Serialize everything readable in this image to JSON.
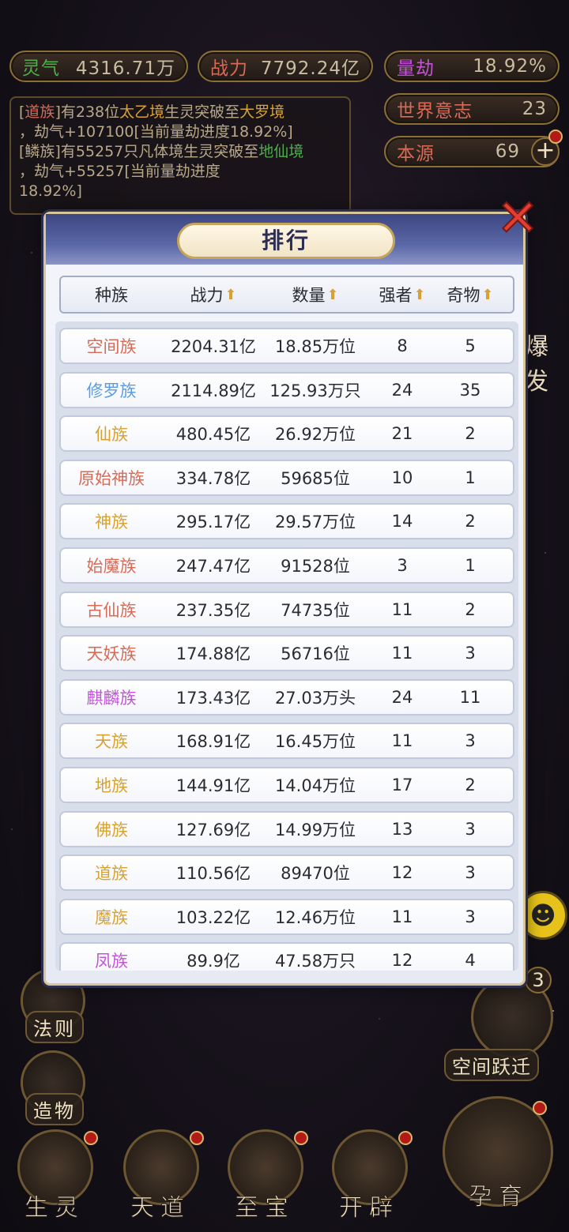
{
  "top_stats": {
    "lingqi": {
      "label": "灵气",
      "value": "4316.71万"
    },
    "zhanli": {
      "label": "战力",
      "value": "7792.24亿"
    },
    "liangjie": {
      "label": "量劫",
      "value": "18.92%"
    },
    "world_will": {
      "label": "世界意志",
      "value": "23"
    },
    "benyuan": {
      "label": "本源",
      "value": "69"
    }
  },
  "colors": {
    "red": "#d96a56",
    "gold": "#d7a234",
    "green": "#4bb04a",
    "blue": "#5b9be0",
    "purple": "#c254d6"
  },
  "log": {
    "line1_a": "[",
    "line1_race": "道族",
    "line1_b": "]有238位",
    "line1_realm1": "太乙境",
    "line1_c": "生灵突破至",
    "line1_realm2": "大罗境",
    "line2": "，劫气+107100[当前量劫进度18.92%]",
    "line3_a": "[鳞族]有55257只凡体境生灵突破至",
    "line3_realm": "地仙境",
    "line4": "，劫气+55257[当前量劫进度",
    "line5": "18.92%]"
  },
  "side": {
    "fa_ze": "法则",
    "zao_wu": "造物",
    "kong_jian": "空间跃迁",
    "bao_fa": "爆发",
    "badge": "3"
  },
  "bottom": {
    "sheng_ling": "生灵",
    "tian_dao": "天道",
    "zhi_bao": "至宝",
    "kai_pi": "开辟",
    "yun_yu": "孕育"
  },
  "modal": {
    "title": "排行",
    "close_icon": "close-x-icon",
    "columns": {
      "race": "种族",
      "power": "战力",
      "count": "数量",
      "strong": "强者",
      "treasure": "奇物"
    },
    "sort_arrow": "⬆",
    "rows": [
      {
        "race": "空间族",
        "color": "#d96a56",
        "power": "2204.31亿",
        "count": "18.85万位",
        "strong": "8",
        "treasure": "5"
      },
      {
        "race": "修罗族",
        "color": "#5b9be0",
        "power": "2114.89亿",
        "count": "125.93万只",
        "strong": "24",
        "treasure": "35"
      },
      {
        "race": "仙族",
        "color": "#d7a234",
        "power": "480.45亿",
        "count": "26.92万位",
        "strong": "21",
        "treasure": "2"
      },
      {
        "race": "原始神族",
        "color": "#d96a56",
        "power": "334.78亿",
        "count": "59685位",
        "strong": "10",
        "treasure": "1"
      },
      {
        "race": "神族",
        "color": "#d7a234",
        "power": "295.17亿",
        "count": "29.57万位",
        "strong": "14",
        "treasure": "2"
      },
      {
        "race": "始魔族",
        "color": "#d96a56",
        "power": "247.47亿",
        "count": "91528位",
        "strong": "3",
        "treasure": "1"
      },
      {
        "race": "古仙族",
        "color": "#d96a56",
        "power": "237.35亿",
        "count": "74735位",
        "strong": "11",
        "treasure": "2"
      },
      {
        "race": "天妖族",
        "color": "#d96a56",
        "power": "174.88亿",
        "count": "56716位",
        "strong": "11",
        "treasure": "3"
      },
      {
        "race": "麒麟族",
        "color": "#c254d6",
        "power": "173.43亿",
        "count": "27.03万头",
        "strong": "24",
        "treasure": "11"
      },
      {
        "race": "天族",
        "color": "#d7a234",
        "power": "168.91亿",
        "count": "16.45万位",
        "strong": "11",
        "treasure": "3"
      },
      {
        "race": "地族",
        "color": "#d7a234",
        "power": "144.91亿",
        "count": "14.04万位",
        "strong": "17",
        "treasure": "2"
      },
      {
        "race": "佛族",
        "color": "#d7a234",
        "power": "127.69亿",
        "count": "14.99万位",
        "strong": "13",
        "treasure": "3"
      },
      {
        "race": "道族",
        "color": "#d7a234",
        "power": "110.56亿",
        "count": "89470位",
        "strong": "12",
        "treasure": "3"
      },
      {
        "race": "魔族",
        "color": "#d7a234",
        "power": "103.22亿",
        "count": "12.46万位",
        "strong": "11",
        "treasure": "3"
      },
      {
        "race": "凤族",
        "color": "#c254d6",
        "power": "89.9亿",
        "count": "47.58万只",
        "strong": "12",
        "treasure": "4"
      }
    ]
  }
}
